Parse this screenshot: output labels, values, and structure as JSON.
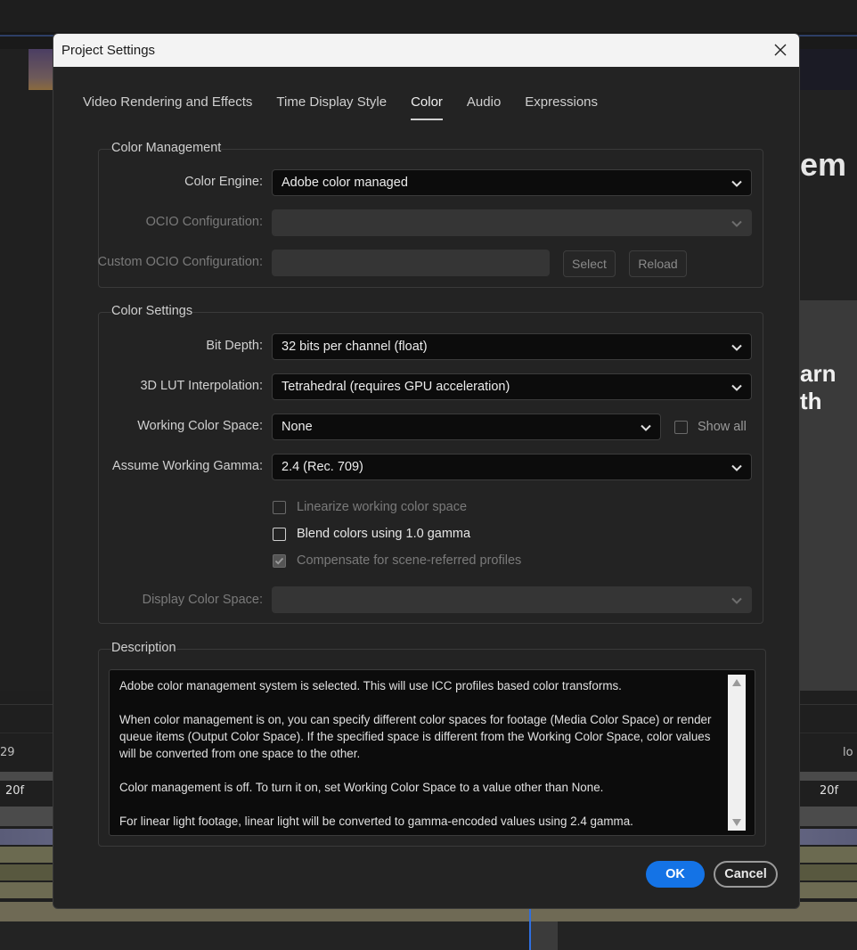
{
  "background": {
    "word_top": "em",
    "word_mid": "arn th",
    "timeline_left_number": "29",
    "timeline_right_text": "lo",
    "ruler_left": "20f",
    "ruler_right": "20f"
  },
  "dialog": {
    "title": "Project Settings",
    "close_icon": "close-icon",
    "tabs": [
      {
        "label": "Video Rendering and Effects",
        "active": false
      },
      {
        "label": "Time Display Style",
        "active": false
      },
      {
        "label": "Color",
        "active": true
      },
      {
        "label": "Audio",
        "active": false
      },
      {
        "label": "Expressions",
        "active": false
      }
    ],
    "color_management": {
      "title": "Color Management",
      "color_engine_label": "Color Engine:",
      "color_engine_value": "Adobe color managed",
      "ocio_label": "OCIO Configuration:",
      "ocio_value": "",
      "custom_ocio_label": "Custom OCIO Configuration:",
      "custom_ocio_value": "",
      "select_button": "Select",
      "reload_button": "Reload"
    },
    "color_settings": {
      "title": "Color Settings",
      "bit_depth_label": "Bit Depth:",
      "bit_depth_value": "32 bits per channel (float)",
      "lut_label": "3D LUT Interpolation:",
      "lut_value": "Tetrahedral (requires GPU acceleration)",
      "working_space_label": "Working Color Space:",
      "working_space_value": "None",
      "show_all_label": "Show all",
      "show_all_checked": false,
      "gamma_label": "Assume Working Gamma:",
      "gamma_value": "2.4 (Rec. 709)",
      "linearize_label": "Linearize working color space",
      "linearize_checked": false,
      "blend_label": "Blend colors using 1.0 gamma",
      "blend_checked": false,
      "compensate_label": "Compensate for scene-referred profiles",
      "compensate_checked": true,
      "display_space_label": "Display Color Space:",
      "display_space_value": ""
    },
    "description": {
      "title": "Description",
      "paragraphs": [
        "Adobe color management system is selected. This will use ICC profiles based color transforms.",
        "When color management is on, you can specify different color spaces for footage (Media Color Space) or render queue items (Output Color Space). If the specified space is different from the Working Color Space, color values will be converted from one space to the other.",
        "Color management is off. To turn it on, set Working Color Space to a value other than None.",
        "For linear light footage, linear light will be converted to gamma-encoded values using 2.4 gamma."
      ]
    },
    "ok_button": "OK",
    "cancel_button": "Cancel"
  },
  "colors": {
    "accent": "#1473e6",
    "dialog_bg": "#232323",
    "titlebar_bg": "#f3f3f3"
  }
}
